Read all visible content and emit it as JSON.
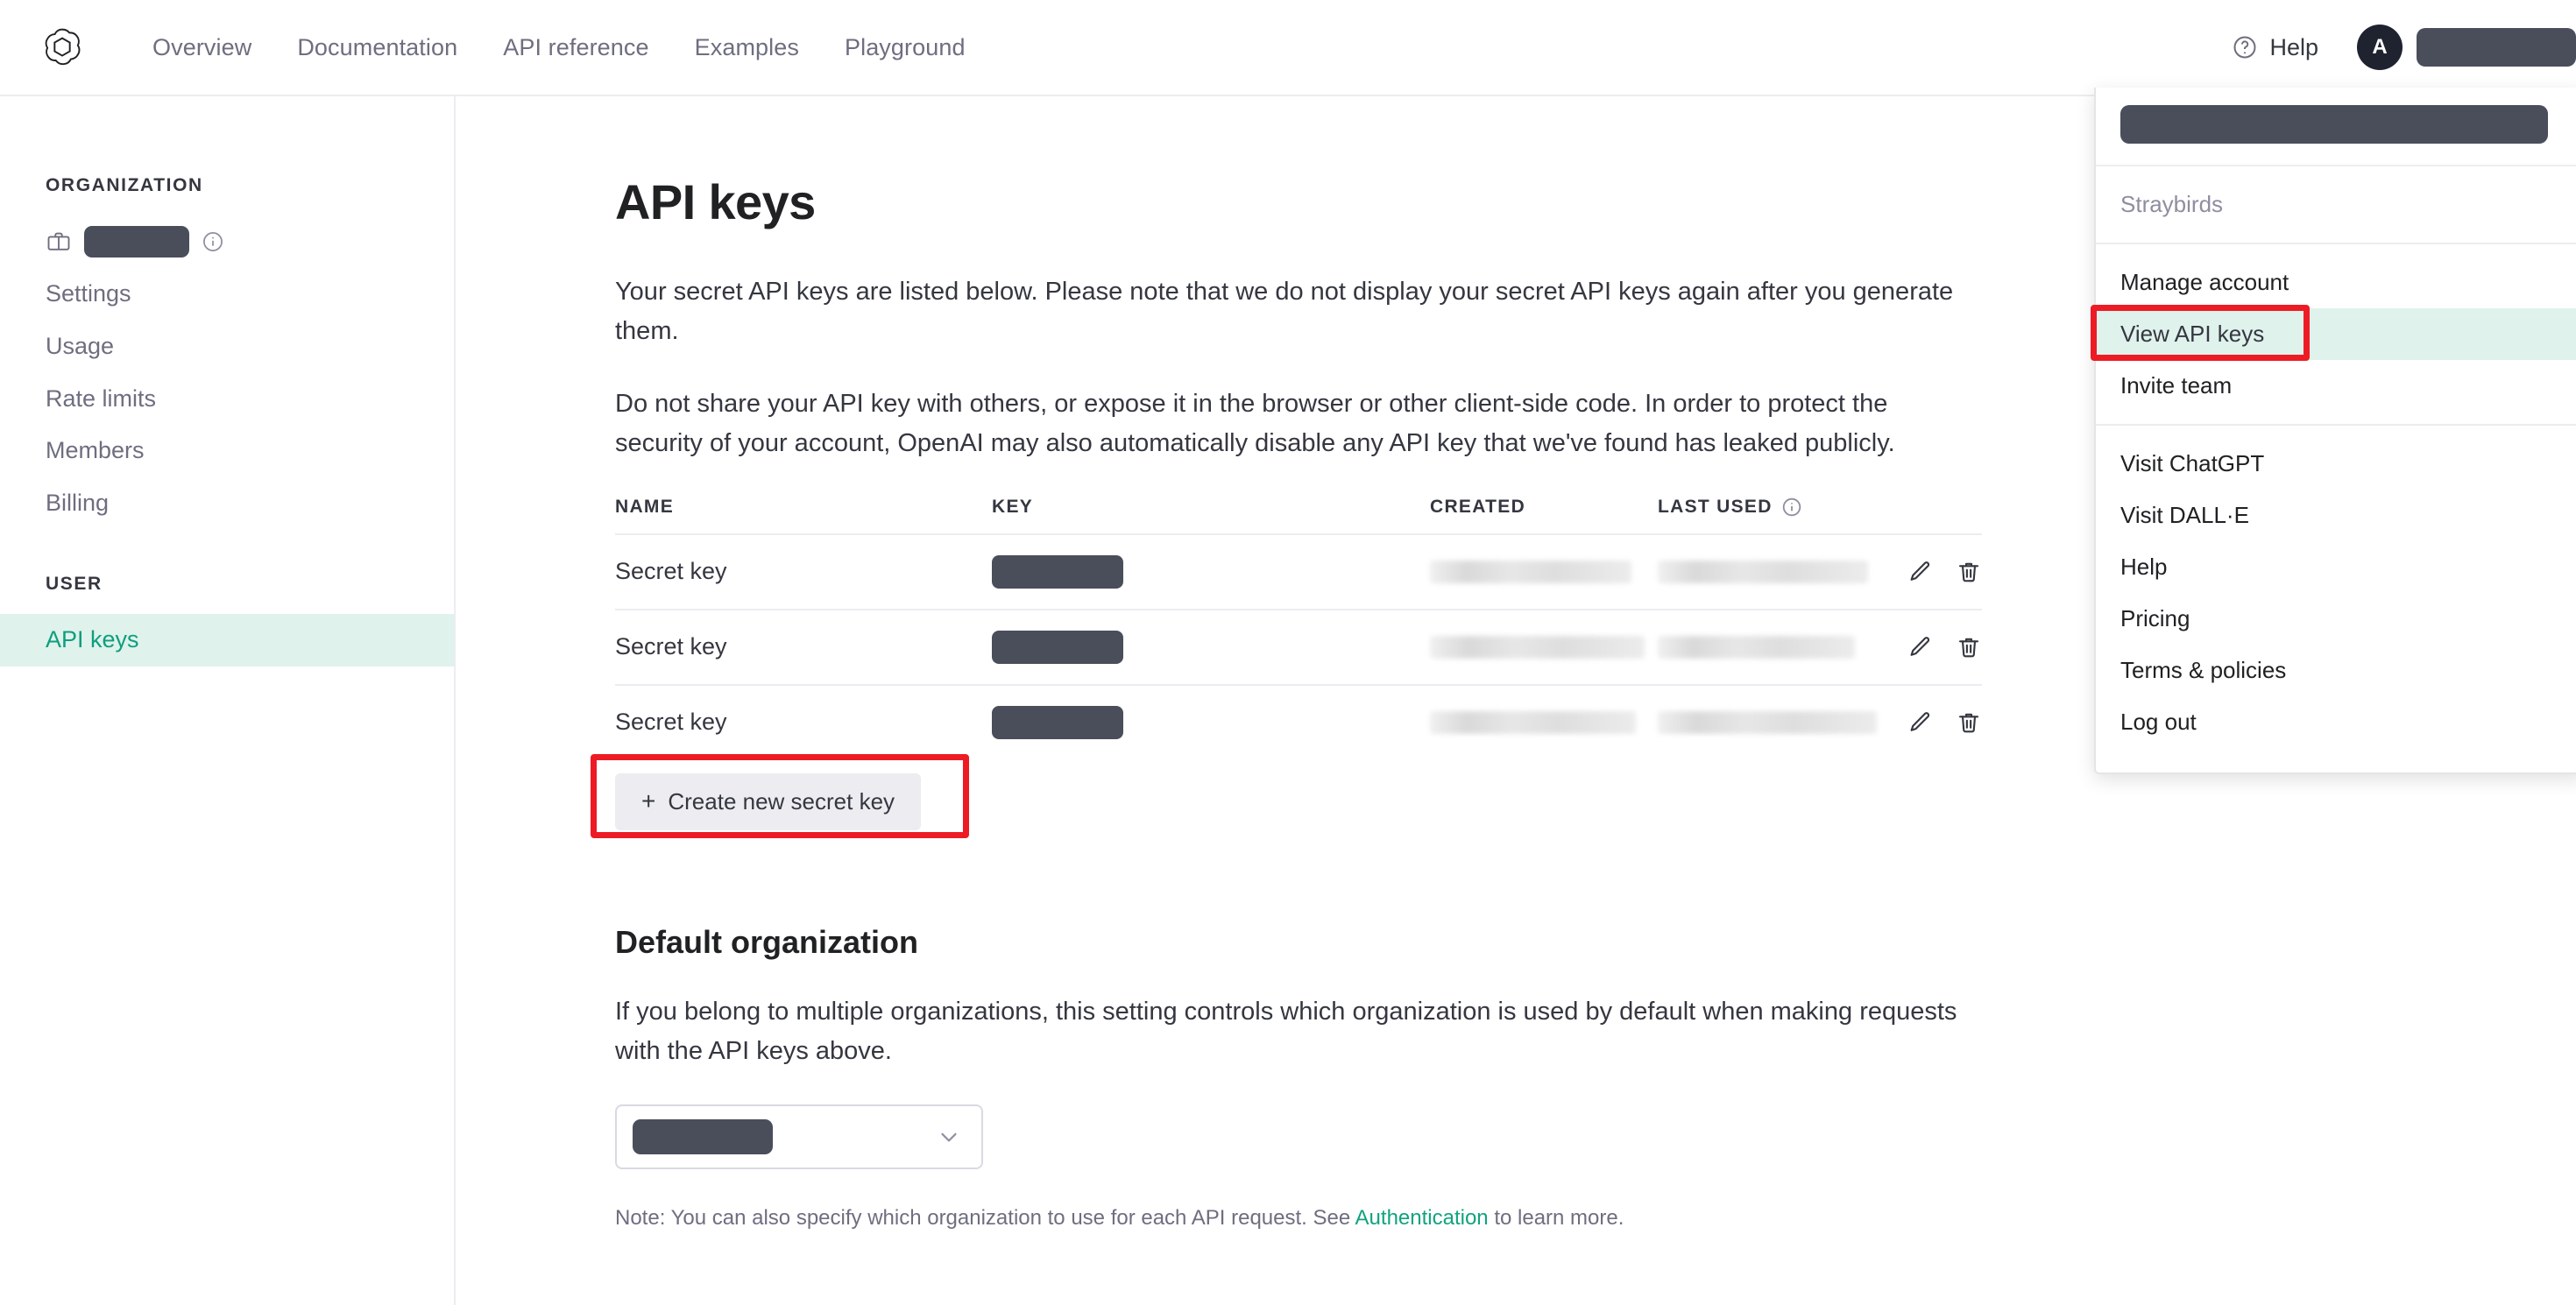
{
  "colors": {
    "accent_teal": "#10a37f",
    "highlight_bg": "#dff2ec",
    "annotation_red": "#ed1c24",
    "redaction_dark": "#4a4e5b",
    "button_gray": "#ececf1"
  },
  "topbar": {
    "logo": "openai-logo",
    "nav": [
      {
        "label": "Overview"
      },
      {
        "label": "Documentation"
      },
      {
        "label": "API reference"
      },
      {
        "label": "Examples"
      },
      {
        "label": "Playground"
      }
    ],
    "help_label": "Help",
    "help_icon": "question-circle-icon",
    "avatar_initial": "A",
    "user_name_redacted": ""
  },
  "sidebar": {
    "org_heading": "ORGANIZATION",
    "org_name_redacted": "",
    "org_icon": "briefcase-icon",
    "org_info_icon": "info-circle-icon",
    "org_items": [
      {
        "label": "Settings"
      },
      {
        "label": "Usage"
      },
      {
        "label": "Rate limits"
      },
      {
        "label": "Members"
      },
      {
        "label": "Billing"
      }
    ],
    "user_heading": "USER",
    "user_items": [
      {
        "label": "API keys",
        "active": true
      }
    ]
  },
  "main": {
    "title": "API keys",
    "paragraph1": "Your secret API keys are listed below. Please note that we do not display your secret API keys again after you generate them.",
    "paragraph2": "Do not share your API key with others, or expose it in the browser or other client-side code. In order to protect the security of your account, OpenAI may also automatically disable any API key that we've found has leaked publicly.",
    "table": {
      "headers": {
        "name": "NAME",
        "key": "KEY",
        "created": "CREATED",
        "last_used": "LAST USED",
        "last_used_info_icon": "info-circle-icon"
      },
      "rows": [
        {
          "name": "Secret key",
          "key_redacted": "",
          "created_blurred": "",
          "last_used_blurred": "",
          "edit_icon": "pencil-icon",
          "delete_icon": "trash-icon"
        },
        {
          "name": "Secret key",
          "key_redacted": "",
          "created_blurred": "",
          "last_used_blurred": "",
          "edit_icon": "pencil-icon",
          "delete_icon": "trash-icon"
        },
        {
          "name": "Secret key",
          "key_redacted": "",
          "created_blurred": "",
          "last_used_blurred": "",
          "edit_icon": "pencil-icon",
          "delete_icon": "trash-icon"
        }
      ]
    },
    "create_button": {
      "label": "Create new secret key",
      "plus": "+",
      "annotated": true
    },
    "default_org": {
      "title": "Default organization",
      "description": "If you belong to multiple organizations, this setting controls which organization is used by default when making requests with the API keys above.",
      "selected_value_redacted": "",
      "chevron_icon": "chevron-down-icon",
      "note_prefix": "Note: You can also specify which organization to use for each API request. See ",
      "note_link": "Authentication",
      "note_suffix": " to learn more."
    }
  },
  "account_menu": {
    "header_name_redacted": "",
    "org_label": "Straybirds",
    "group1": [
      {
        "label": "Manage account",
        "highlighted": false
      },
      {
        "label": "View API keys",
        "highlighted": true,
        "annotated": true
      },
      {
        "label": "Invite team",
        "highlighted": false
      }
    ],
    "group2": [
      {
        "label": "Visit ChatGPT"
      },
      {
        "label": "Visit DALL·E"
      },
      {
        "label": "Help"
      },
      {
        "label": "Pricing"
      },
      {
        "label": "Terms & policies"
      },
      {
        "label": "Log out"
      }
    ]
  }
}
